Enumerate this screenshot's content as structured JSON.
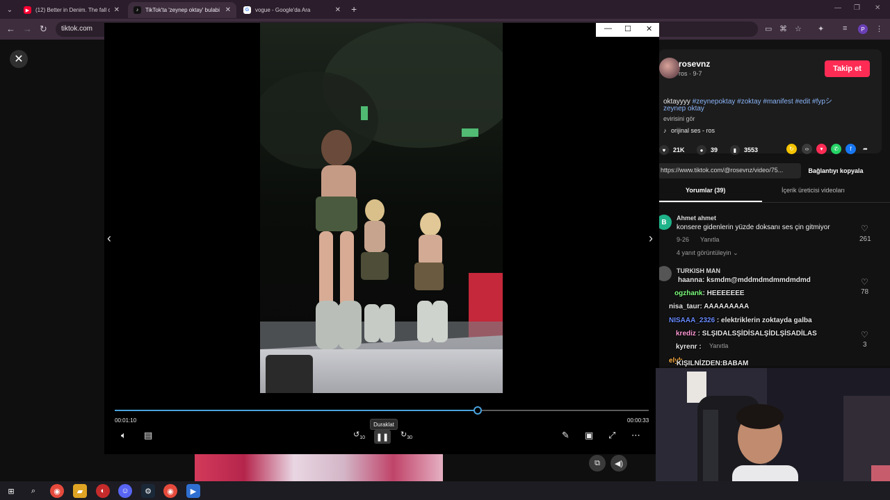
{
  "browser": {
    "tabs": [
      {
        "title": "(12) Better in Denim. The fall ca",
        "favicon": "youtube-icon",
        "color": "#ff0033"
      },
      {
        "title": "TikTok'ta 'zeynep oktay' bulabi",
        "favicon": "tiktok-icon",
        "color": "#111111"
      },
      {
        "title": "vogue - Google'da Ara",
        "favicon": "google-icon",
        "color": "#4285f4"
      }
    ],
    "address": "tiktok.com",
    "profile_initial": "P"
  },
  "post": {
    "username": "rosevnz",
    "subline": "ros · 9-7",
    "follow_label": "Takip et",
    "caption_prefix": "oktayyyy ",
    "caption_tags": "#zeynepoktay #zoktay #manifest #edit #fypシ",
    "caption_line2": "zeynep oktay",
    "translate_label": "evirisini gör",
    "music": "orijinal ses - ros",
    "likes": "21K",
    "comments": "39",
    "saves": "3553",
    "url": "https://www.tiktok.com/@rosevnz/video/75...",
    "copy_label": "Bağlantıyı kopyala",
    "tab_comments": "Yorumlar (39)",
    "tab_creator": "İçerik üreticisi videoları"
  },
  "comments": [
    {
      "name": "Ahmet ahmet",
      "avatar_letter": "B",
      "text": "konsere gidenlerin yüzde doksanı ses çin gitmiyor",
      "date": "9-26",
      "reply": "Yanıtla",
      "replies": "4 yanıt görüntüleyin",
      "likes": "261"
    },
    {
      "name": "TURKISH MAN",
      "likes": "78"
    },
    {
      "name": "",
      "reply": "Yanıtla",
      "likes": "3"
    }
  ],
  "chat": [
    {
      "user": "",
      "msg": "haanna: ksmdm@mddmdmdmmdmdmd",
      "color": "#9ad0ff"
    },
    {
      "user": "ogzhank",
      "msg": ": HEEEEEEE",
      "color": "#7fff7f"
    },
    {
      "user": "nisa_taur",
      "msg": ": AAAAAAAAA",
      "color": "#ffffff"
    },
    {
      "user": "NISAAA_2326",
      "msg": " : elektriklerin zoktayda galba",
      "color": "#6a8cff"
    },
    {
      "user": "krediz",
      "msg": " : SLŞIDALSŞİDİSALŞİDLŞİSADİLAS",
      "color": "#ff9ad5"
    },
    {
      "user": "kyrenr",
      "msg": " :",
      "color": "#ffffff"
    },
    {
      "user": "elyh",
      "msg": "",
      "color": "#ffb347"
    },
    {
      "user": "KIŞIL",
      "msg": "NİZDEN:BABAM",
      "color": "#ffffff"
    }
  ],
  "viewer": {
    "time_elapsed": "00:01:10",
    "time_remaining": "00:00:33",
    "progress": 0.68,
    "tooltip": "Duraklat",
    "rewind": "10",
    "forward": "30"
  }
}
